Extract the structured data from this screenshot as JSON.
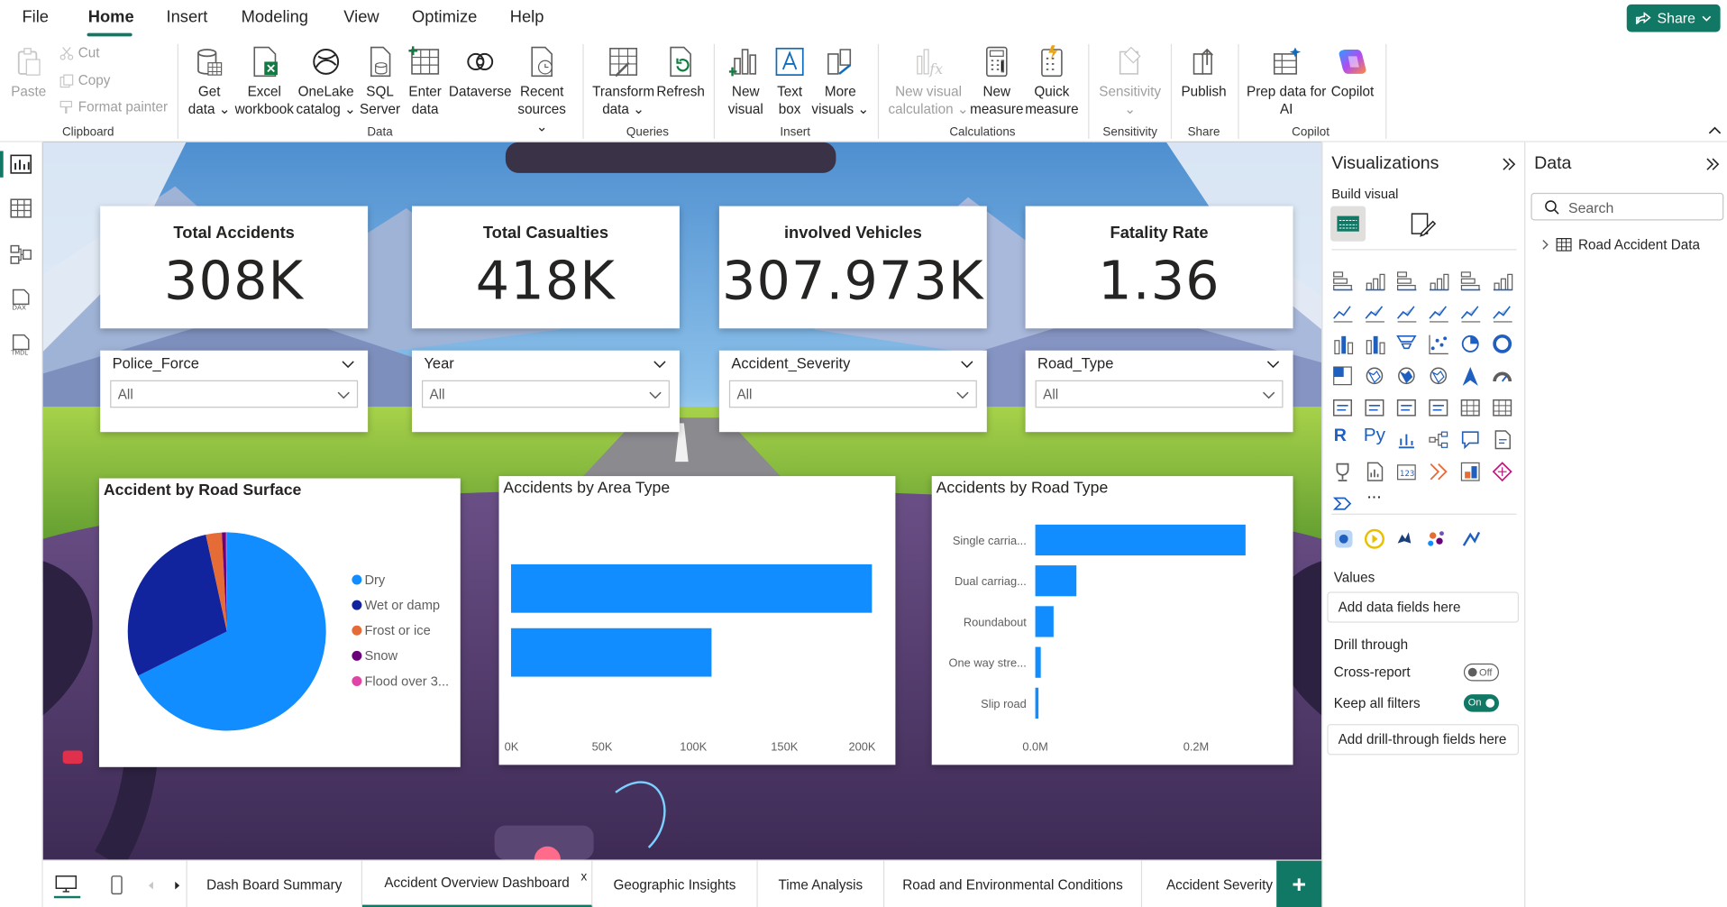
{
  "menu": {
    "items": [
      "File",
      "Home",
      "Insert",
      "Modeling",
      "View",
      "Optimize",
      "Help"
    ],
    "share_label": "Share"
  },
  "ribbon": {
    "clipboard": {
      "paste": "Paste",
      "cut": "Cut",
      "copy": "Copy",
      "format_painter": "Format painter",
      "group": "Clipboard"
    },
    "data": {
      "get_data": [
        "Get",
        "data"
      ],
      "excel": [
        "Excel",
        "workbook"
      ],
      "onelake": [
        "OneLake",
        "catalog"
      ],
      "sql": [
        "SQL",
        "Server"
      ],
      "enter": [
        "Enter",
        "data"
      ],
      "dataverse": "Dataverse",
      "recent": [
        "Recent",
        "sources"
      ],
      "group": "Data"
    },
    "queries": {
      "transform": [
        "Transform",
        "data"
      ],
      "refresh": "Refresh",
      "group": "Queries"
    },
    "insert": {
      "new_visual": [
        "New",
        "visual"
      ],
      "text_box": [
        "Text",
        "box"
      ],
      "more_visuals": [
        "More",
        "visuals"
      ],
      "group": "Insert"
    },
    "calculations": {
      "new_visual_calc": [
        "New visual",
        "calculation"
      ],
      "new_measure": [
        "New",
        "measure"
      ],
      "quick_measure": [
        "Quick",
        "measure"
      ],
      "group": "Calculations"
    },
    "sensitivity": {
      "label": "Sensitivity",
      "group": "Sensitivity"
    },
    "share": {
      "publish": "Publish",
      "group": "Share"
    },
    "copilot": {
      "prep": [
        "Prep data for",
        "AI"
      ],
      "copilot": "Copilot",
      "group": "Copilot"
    }
  },
  "kpis": [
    {
      "title": "Total Accidents",
      "value": "308K"
    },
    {
      "title": "Total Casualties",
      "value": "418K"
    },
    {
      "title": "involved Vehicles",
      "value": "307.973K"
    },
    {
      "title": "Fatality Rate",
      "value": "1.36"
    }
  ],
  "slicers": [
    {
      "title": "Police_Force",
      "value": "All"
    },
    {
      "title": "Year",
      "value": "All"
    },
    {
      "title": "Accident_Severity",
      "value": "All"
    },
    {
      "title": "Road_Type",
      "value": "All"
    }
  ],
  "chart_data": [
    {
      "type": "pie",
      "title": "Accident by Road Surface",
      "categories": [
        "Dry",
        "Wet or damp",
        "Frost or ice",
        "Snow",
        "Flood over 3..."
      ],
      "values": [
        208,
        89,
        8,
        2,
        0.5
      ],
      "colors": [
        "#118DFF",
        "#12239E",
        "#E66C37",
        "#6B007B",
        "#E044A7"
      ],
      "legend_position": "right"
    },
    {
      "type": "bar",
      "title": "Accidents by Area Type",
      "orientation": "horizontal",
      "categories": [
        "",
        ""
      ],
      "values": [
        198000,
        110000
      ],
      "xticks": [
        "0K",
        "50K",
        "100K",
        "150K",
        "200K"
      ],
      "xlim": [
        0,
        200000
      ],
      "color": "#118DFF"
    },
    {
      "type": "bar",
      "title": "Accidents by Road Type",
      "orientation": "horizontal",
      "categories": [
        "Single carria...",
        "Dual carriag...",
        "Roundabout",
        "One way stre...",
        "Slip road"
      ],
      "values": [
        230000,
        45000,
        20000,
        6000,
        3500
      ],
      "xticks": [
        "0.0M",
        "0.2M"
      ],
      "xlim": [
        0,
        0.3
      ],
      "color": "#118DFF"
    }
  ],
  "viz_pane": {
    "title": "Visualizations",
    "build_visual": "Build visual",
    "values_label": "Values",
    "values_well": "Add data fields here",
    "drill_through": "Drill through",
    "cross_report": "Cross-report",
    "cross_report_state": "Off",
    "keep_filters": "Keep all filters",
    "keep_filters_state": "On",
    "drill_well": "Add drill-through fields here",
    "r_label": "R",
    "py_label": "Py",
    "more": "..."
  },
  "data_pane": {
    "title": "Data",
    "search_placeholder": "Search",
    "table": "Road Accident Data"
  },
  "tabs": [
    "Dash Board Summary",
    "Accident Overview Dashboard",
    "Geographic Insights",
    "Time Analysis",
    "Road and Environmental Conditions",
    "Accident Severity &"
  ],
  "close_tab": "x",
  "add_tab": "+",
  "accent": "#117865"
}
